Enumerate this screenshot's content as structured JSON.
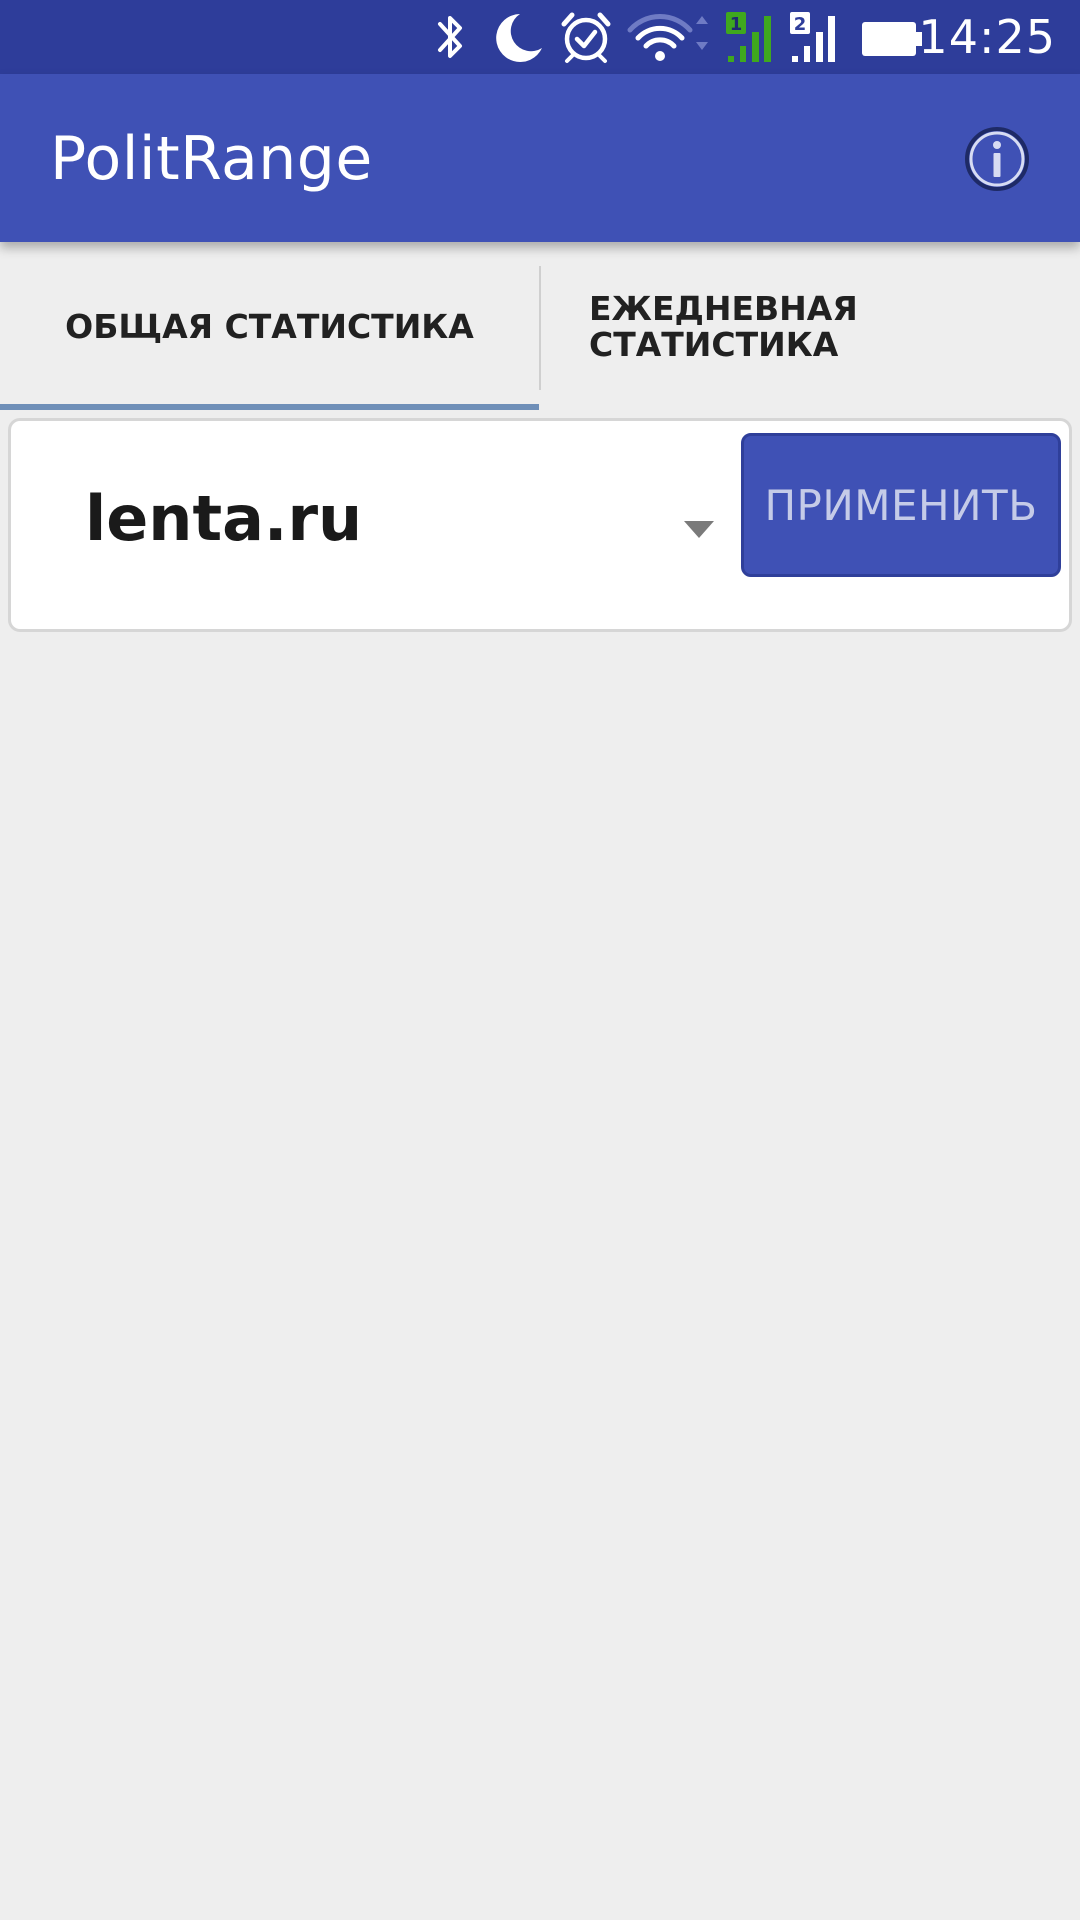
{
  "status_bar": {
    "time": "14:25",
    "sim1_label": "1",
    "sim2_label": "2",
    "icons": [
      "bluetooth-icon",
      "moon-icon",
      "alarm-icon",
      "wifi-icon",
      "signal-sim1-icon",
      "signal-sim2-icon",
      "battery-icon"
    ],
    "sim1_color": "#3fa81e"
  },
  "app_bar": {
    "title": "PolitRange",
    "info_icon": "info-icon",
    "background": "#3f51b5"
  },
  "tabs": [
    {
      "label": "ОБЩАЯ СТАТИСТИКА",
      "selected": true
    },
    {
      "label": "ЕЖЕДНЕВНАЯ СТАТИСТИКА",
      "selected": false
    }
  ],
  "source_selector": {
    "selected_value": "lenta.ru"
  },
  "apply_button": {
    "label": "ПРИМЕНИТЬ"
  }
}
